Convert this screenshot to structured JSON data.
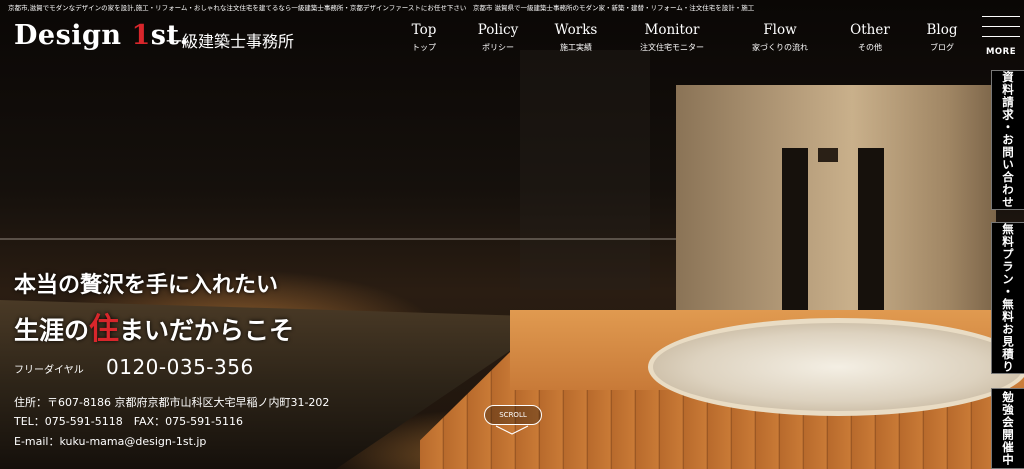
{
  "header": {
    "tagline": "京都市,滋賀でモダンなデザインの家を設計,施工・リフォーム・おしゃれな注文住宅を建てるなら一級建築士事務所・京都デザインファーストにお任せ下さい　京都市 滋賀県で一級建築士事務所のモダン家・新築・建替・リフォーム・注文住宅を設計・施工",
    "logo_main": "Design ",
    "logo_accent": "1",
    "logo_tail": "st.",
    "firm_type": "一級建築士事務所"
  },
  "nav": [
    {
      "en": "Top",
      "ja": "トップ"
    },
    {
      "en": "Policy",
      "ja": "ポリシー"
    },
    {
      "en": "Works",
      "ja": "施工実績"
    },
    {
      "en": "Monitor",
      "ja": "注文住宅モニター"
    },
    {
      "en": "Flow",
      "ja": "家づくりの流れ"
    },
    {
      "en": "Other",
      "ja": "その他"
    },
    {
      "en": "Blog",
      "ja": "ブログ"
    }
  ],
  "menu_label": "MORE",
  "side_tabs": [
    {
      "label": "資料請求・お問い合わせ"
    },
    {
      "label": "無料プラン・無料お見積り"
    },
    {
      "label": "勉強会開催中"
    }
  ],
  "hero": {
    "catch_line1": "本当の贅沢を手に入れたい",
    "catch_line2_pre": "生涯の",
    "catch_line2_accent": "住",
    "catch_line2_post": "まいだからこそ",
    "phone_label": "フリーダイヤル",
    "phone_number": "0120-035-356",
    "address": "住所：〒607-8186 京都府京都市山科区大宅早稲ノ内町31-202",
    "tel_fax": "TEL：075-591-5118　FAX：075-591-5116",
    "email": "E-mail：kuku-mama@design-1st.jp",
    "scroll_label": "SCROLL"
  },
  "colors": {
    "accent": "#d8262b",
    "tab_bg": "#000000"
  }
}
